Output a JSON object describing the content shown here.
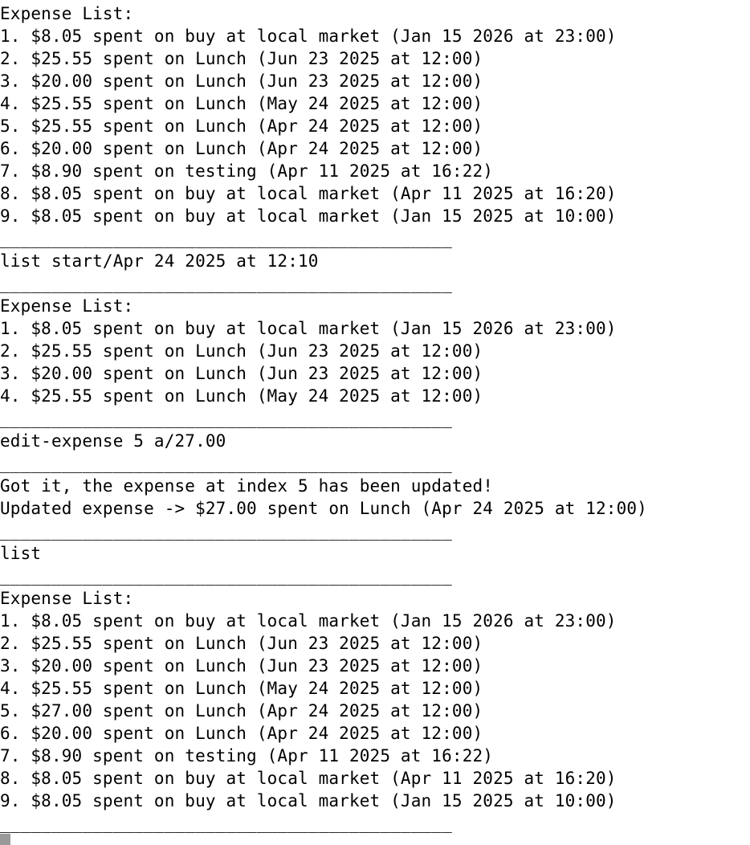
{
  "terminal": {
    "blocks": [
      {
        "kind": "header",
        "text": "Expense List:"
      },
      {
        "kind": "line",
        "text": "1. $8.05 spent on buy at local market (Jan 15 2026 at 23:00)"
      },
      {
        "kind": "line",
        "text": "2. $25.55 spent on Lunch (Jun 23 2025 at 12:00)"
      },
      {
        "kind": "line",
        "text": "3. $20.00 spent on Lunch (Jun 23 2025 at 12:00)"
      },
      {
        "kind": "line",
        "text": "4. $25.55 spent on Lunch (May 24 2025 at 12:00)"
      },
      {
        "kind": "line",
        "text": "5. $25.55 spent on Lunch (Apr 24 2025 at 12:00)"
      },
      {
        "kind": "line",
        "text": "6. $20.00 spent on Lunch (Apr 24 2025 at 12:00)"
      },
      {
        "kind": "line",
        "text": "7. $8.90 spent on testing (Apr 11 2025 at 16:22)"
      },
      {
        "kind": "line",
        "text": "8. $8.05 spent on buy at local market (Apr 11 2025 at 16:20)"
      },
      {
        "kind": "line",
        "text": "9. $8.05 spent on buy at local market (Jan 15 2025 at 10:00)"
      },
      {
        "kind": "separator",
        "text": "____________________________________________"
      },
      {
        "kind": "command",
        "text": "list start/Apr 24 2025 at 12:10"
      },
      {
        "kind": "separator",
        "text": "____________________________________________"
      },
      {
        "kind": "header",
        "text": "Expense List:"
      },
      {
        "kind": "line",
        "text": "1. $8.05 spent on buy at local market (Jan 15 2026 at 23:00)"
      },
      {
        "kind": "line",
        "text": "2. $25.55 spent on Lunch (Jun 23 2025 at 12:00)"
      },
      {
        "kind": "line",
        "text": "3. $20.00 spent on Lunch (Jun 23 2025 at 12:00)"
      },
      {
        "kind": "line",
        "text": "4. $25.55 spent on Lunch (May 24 2025 at 12:00)"
      },
      {
        "kind": "separator",
        "text": "____________________________________________"
      },
      {
        "kind": "command",
        "text": "edit-expense 5 a/27.00"
      },
      {
        "kind": "separator",
        "text": "____________________________________________"
      },
      {
        "kind": "line",
        "text": "Got it, the expense at index 5 has been updated!"
      },
      {
        "kind": "line",
        "text": "Updated expense -> $27.00 spent on Lunch (Apr 24 2025 at 12:00)"
      },
      {
        "kind": "separator",
        "text": "____________________________________________"
      },
      {
        "kind": "command",
        "text": "list"
      },
      {
        "kind": "separator",
        "text": "____________________________________________"
      },
      {
        "kind": "header",
        "text": "Expense List:"
      },
      {
        "kind": "line",
        "text": "1. $8.05 spent on buy at local market (Jan 15 2026 at 23:00)"
      },
      {
        "kind": "line",
        "text": "2. $25.55 spent on Lunch (Jun 23 2025 at 12:00)"
      },
      {
        "kind": "line",
        "text": "3. $20.00 spent on Lunch (Jun 23 2025 at 12:00)"
      },
      {
        "kind": "line",
        "text": "4. $25.55 spent on Lunch (May 24 2025 at 12:00)"
      },
      {
        "kind": "line",
        "text": "5. $27.00 spent on Lunch (Apr 24 2025 at 12:00)"
      },
      {
        "kind": "line",
        "text": "6. $20.00 spent on Lunch (Apr 24 2025 at 12:00)"
      },
      {
        "kind": "line",
        "text": "7. $8.90 spent on testing (Apr 11 2025 at 16:22)"
      },
      {
        "kind": "line",
        "text": "8. $8.05 spent on buy at local market (Apr 11 2025 at 16:20)"
      },
      {
        "kind": "line",
        "text": "9. $8.05 spent on buy at local market (Jan 15 2025 at 10:00)"
      },
      {
        "kind": "separator",
        "text": "____________________________________________"
      }
    ]
  },
  "colors": {
    "background": "#ffffff",
    "text": "#000000",
    "cursor": "#9a9a9a"
  }
}
